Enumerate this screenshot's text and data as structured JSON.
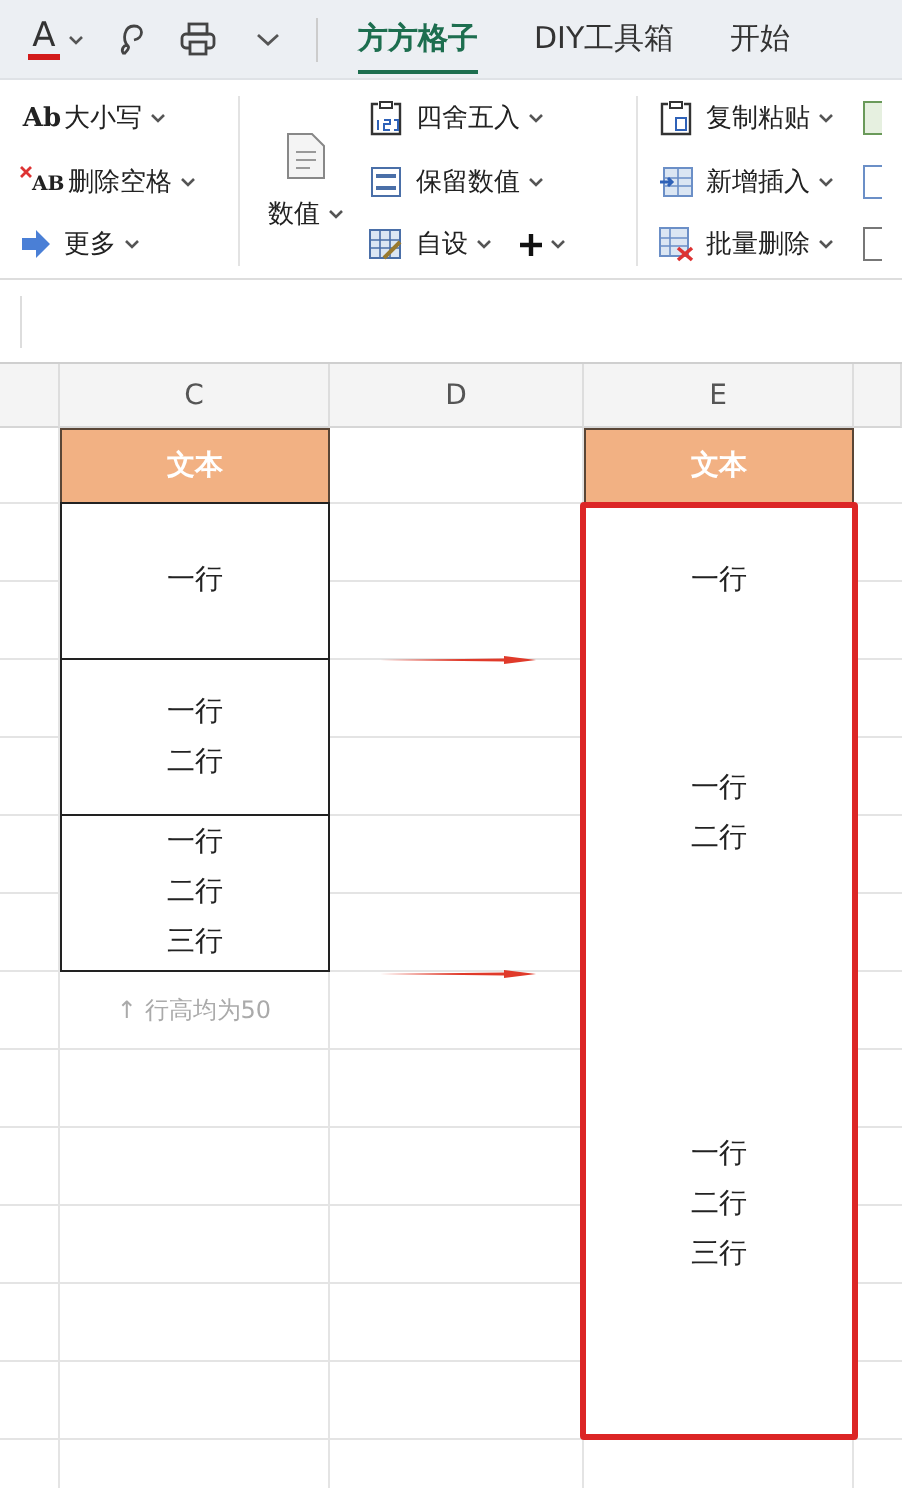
{
  "toolbar": {
    "font_color_label": "A",
    "tabs": [
      {
        "label": "方方格子",
        "selected": true
      },
      {
        "label": "DIY工具箱",
        "selected": false
      },
      {
        "label": "开始",
        "selected": false
      }
    ]
  },
  "ribbon": {
    "groups": [
      {
        "items": [
          {
            "icon_text": "Ab",
            "label": "大小写"
          },
          {
            "icon_text": "AB",
            "label": "删除空格"
          },
          {
            "label": "更多"
          }
        ]
      },
      {
        "big_button": "数值",
        "items": [
          {
            "label": "四舍五入"
          },
          {
            "label": "保留数值"
          },
          {
            "label": "自设"
          }
        ]
      },
      {
        "items": [
          {
            "label": "复制粘贴"
          },
          {
            "label": "新增插入"
          },
          {
            "label": "批量删除"
          }
        ]
      }
    ]
  },
  "sheet": {
    "columns": [
      "C",
      "D",
      "E"
    ],
    "before": {
      "header": "文本",
      "cells": [
        {
          "lines": [
            "一行"
          ]
        },
        {
          "lines": [
            "一行",
            "二行"
          ]
        },
        {
          "lines": [
            "一行",
            "二行",
            "三行"
          ]
        }
      ],
      "note": "↑ 行高均为50"
    },
    "after": {
      "header": "文本",
      "highlighted": true,
      "cells": [
        {
          "lines": [
            "一行"
          ]
        },
        {
          "lines": [
            "一行",
            "二行"
          ]
        },
        {
          "lines": [
            "一行",
            "二行",
            "三行"
          ]
        }
      ]
    }
  }
}
